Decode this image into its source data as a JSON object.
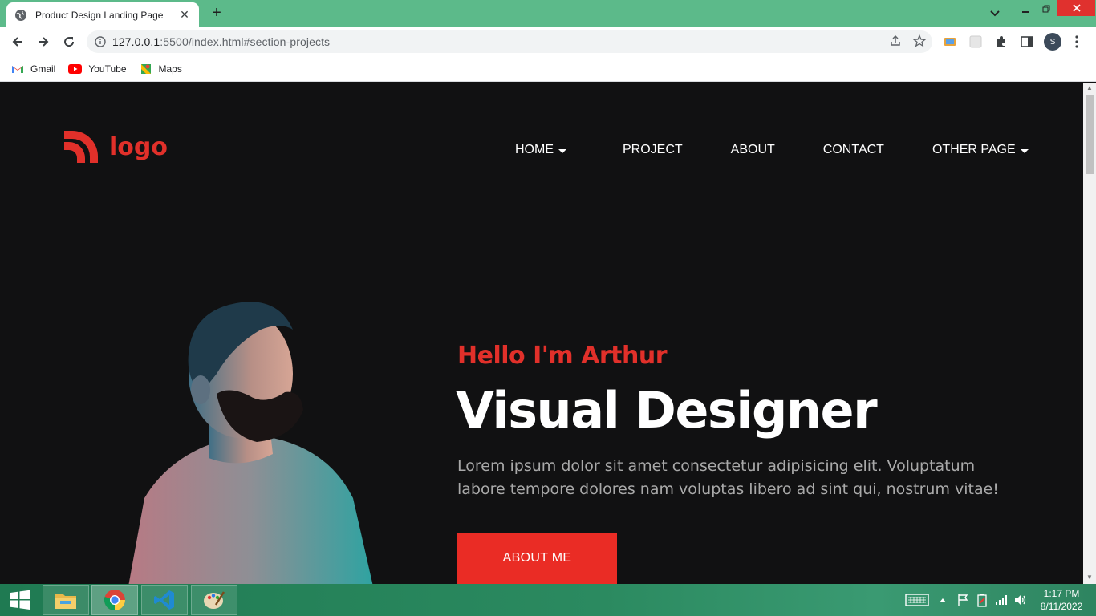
{
  "browser": {
    "tab_title": "Product Design Landing Page",
    "tab_close": "✕",
    "new_tab": "+",
    "url_host": "127.0.0.1",
    "url_rest": ":5500/index.html#section-projects",
    "profile_initial": "S",
    "bookmarks": [
      {
        "label": "Gmail",
        "icon": "gmail-icon"
      },
      {
        "label": "YouTube",
        "icon": "youtube-icon"
      },
      {
        "label": "Maps",
        "icon": "maps-icon"
      }
    ]
  },
  "site": {
    "logo_text": "logo",
    "nav": [
      {
        "label": "HOME",
        "has_dropdown": true
      },
      {
        "label": "PROJECT",
        "has_dropdown": false
      },
      {
        "label": "ABOUT",
        "has_dropdown": false
      },
      {
        "label": "CONTACT",
        "has_dropdown": false
      },
      {
        "label": "OTHER PAGE",
        "has_dropdown": true
      }
    ],
    "hero": {
      "greeting": "Hello I'm Arthur",
      "title": "Visual Designer",
      "description": "Lorem ipsum dolor sit amet consectetur adipisicing elit. Voluptatum labore tempore dolores nam voluptas libero ad sint qui, nostrum vitae!",
      "cta_label": "ABOUT ME"
    },
    "colors": {
      "accent": "#e1302a",
      "background": "#111112",
      "button": "#ea2c25"
    }
  },
  "taskbar": {
    "time": "1:17 PM",
    "date": "8/11/2022",
    "apps": [
      "file-explorer-icon",
      "chrome-icon",
      "vscode-icon",
      "paint-icon"
    ]
  }
}
